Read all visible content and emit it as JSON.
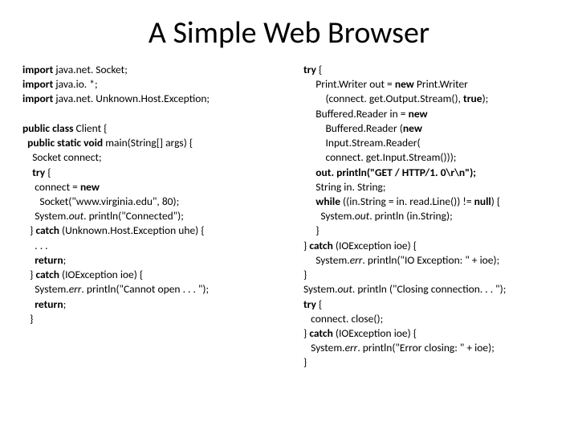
{
  "title": "A Simple Web Browser",
  "left": {
    "l1a": "import ",
    "l1b": "java.net. Socket;",
    "l2a": "import ",
    "l2b": "java.io. *;",
    "l3a": "import ",
    "l3b": "java.net. Unknown.Host.Exception;",
    "l5a": "public class ",
    "l5b": "Client {",
    "l6a": "  public static void ",
    "l6b": "main(String[] args) {",
    "l7": "    Socket connect;",
    "l8a": "    try ",
    "l8b": "{",
    "l9a": "     connect = ",
    "l9b": "new",
    "l10": "       Socket(\"www.virginia.edu\", 80);",
    "l11a": "     System.",
    "l11b": "out",
    "l11c": ". println(\"Connected\");",
    "l12a": "   } ",
    "l12b": "catch ",
    "l12c": "(Unknown.Host.Exception uhe) {",
    "l13": "     . . .",
    "l14a": "     return",
    "l14b": ";",
    "l15a": "   } ",
    "l15b": "catch ",
    "l15c": "(IOException ioe) {",
    "l16a": "     System.",
    "l16b": "err",
    "l16c": ". println(\"Cannot open . . . \");",
    "l17a": "     return",
    "l17b": ";",
    "l18": "   }"
  },
  "right": {
    "r1a": "try ",
    "r1b": "{",
    "r2a": "     Print.Writer out = ",
    "r2b": "new ",
    "r2c": "Print.Writer",
    "r3a": "         (connect. get.Output.Stream(), ",
    "r3b": "true",
    "r3c": ");",
    "r4a": "     Buffered.Reader in = ",
    "r4b": "new",
    "r5a": "         Buffered.Reader (",
    "r5b": "new",
    "r6": "         Input.Stream.Reader(",
    "r7": "         connect. get.Input.Stream()));",
    "r8": "     out. println(\"GET / HTTP/1. 0\\r\\n\");",
    "r9": "     String in. String;",
    "r10a": "     while ",
    "r10b": "((in.String = in. read.Line()) != ",
    "r10c": "null",
    "r10d": ") {",
    "r11a": "       System.",
    "r11b": "out",
    "r11c": ". println (in.String);",
    "r12": "     }",
    "r13a": "} ",
    "r13b": "catch ",
    "r13c": "(IOException ioe) {",
    "r14a": "     System.",
    "r14b": "err",
    "r14c": ". println(\"IO Exception: \" + ioe);",
    "r15": "}",
    "r16a": "System.",
    "r16b": "out",
    "r16c": ". println (\"Closing connection. . . \");",
    "r17a": "try ",
    "r17b": "{",
    "r18": "   connect. close();",
    "r19a": "} ",
    "r19b": "catch ",
    "r19c": "(IOException ioe) {",
    "r20a": "   System.",
    "r20b": "err",
    "r20c": ". println(\"Error closing: \" + ioe);",
    "r21": "}"
  }
}
